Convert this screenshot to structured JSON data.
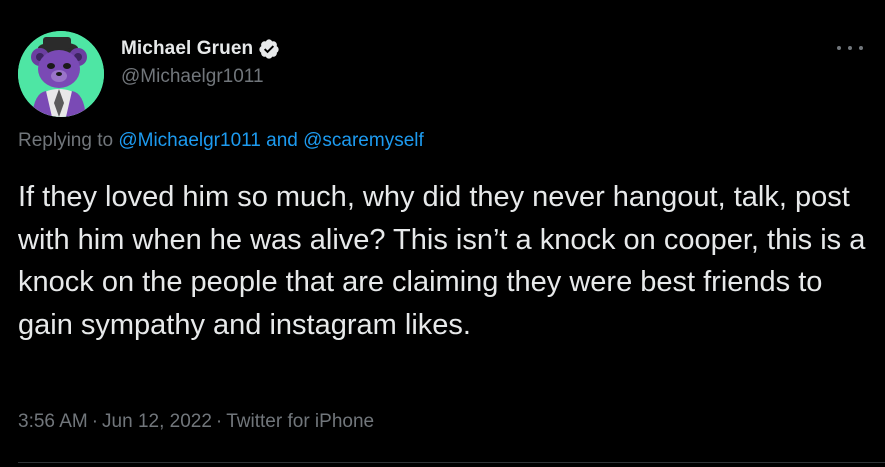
{
  "author": {
    "display_name": "Michael Gruen",
    "handle": "@Michaelgr1011",
    "avatar_icon": "purple-bear-avatar",
    "verified_icon": "verified-badge-icon"
  },
  "menu": {
    "icon": "more-horizontal-icon"
  },
  "reply": {
    "prefix": "Replying to",
    "mention_1": "@Michaelgr1011",
    "joiner": "and",
    "mention_2": "@scaremyself"
  },
  "tweet": {
    "text": "If they loved him so much, why did they never hangout, talk, post with him when he was alive? This isn’t a knock on cooper, this is a knock on the people that are claiming they were best friends to gain sympathy and instagram likes."
  },
  "meta": {
    "time": "3:56 AM",
    "separator": "·",
    "date": "Jun 12, 2022",
    "source": "Twitter for iPhone"
  },
  "colors": {
    "background": "#000000",
    "text": "#e7e9ea",
    "muted": "#71767b",
    "accent": "#1d9bf0",
    "avatar_bg": "#4ee6a4"
  }
}
